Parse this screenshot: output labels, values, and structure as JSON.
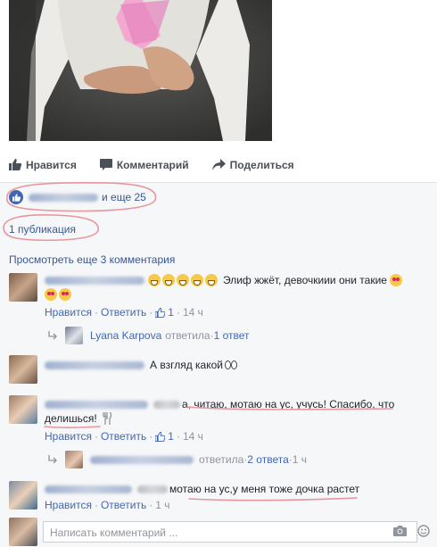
{
  "actions": {
    "like": "Нравится",
    "comment": "Комментарий",
    "share": "Поделиться"
  },
  "likes": {
    "suffix": "и еще 25"
  },
  "post": {
    "shares": "1 публикация"
  },
  "comments_header": {
    "view_more": "Просмотреть еще 3 комментария"
  },
  "comments": [
    {
      "text": "Элиф жжёт, девочкиии они такие",
      "like_label": "Нравится",
      "reply_label": "Ответить",
      "like_count": "1",
      "time": "14 ч",
      "reply": {
        "name": "Lyana Karpova",
        "action": "ответила",
        "count": "1 ответ"
      }
    },
    {
      "text": "А взгляд какой"
    },
    {
      "text_line1": "а, читаю, мотаю на ус, учусь! Спасибо, что",
      "text_line2": "делишься!",
      "like_label": "Нравится",
      "reply_label": "Ответить",
      "like_count": "1",
      "time": "14 ч",
      "reply": {
        "action": "ответила",
        "count": "2 ответа",
        "time": "1 ч"
      }
    },
    {
      "text": "мотаю на ус,у меня тоже дочка растет",
      "like_label": "Нравится",
      "reply_label": "Ответить",
      "time": "1 ч"
    }
  ],
  "composer": {
    "placeholder": "Написать комментарий ..."
  },
  "icons": {
    "like": "thumbs-up-icon",
    "comment": "speech-bubble-icon",
    "share": "share-arrow-icon",
    "camera": "camera-icon",
    "reply_arrow": "reply-arrow-icon"
  },
  "colors": {
    "link": "#365899",
    "accent": "#4267b2",
    "annotation": "#e8959e"
  }
}
